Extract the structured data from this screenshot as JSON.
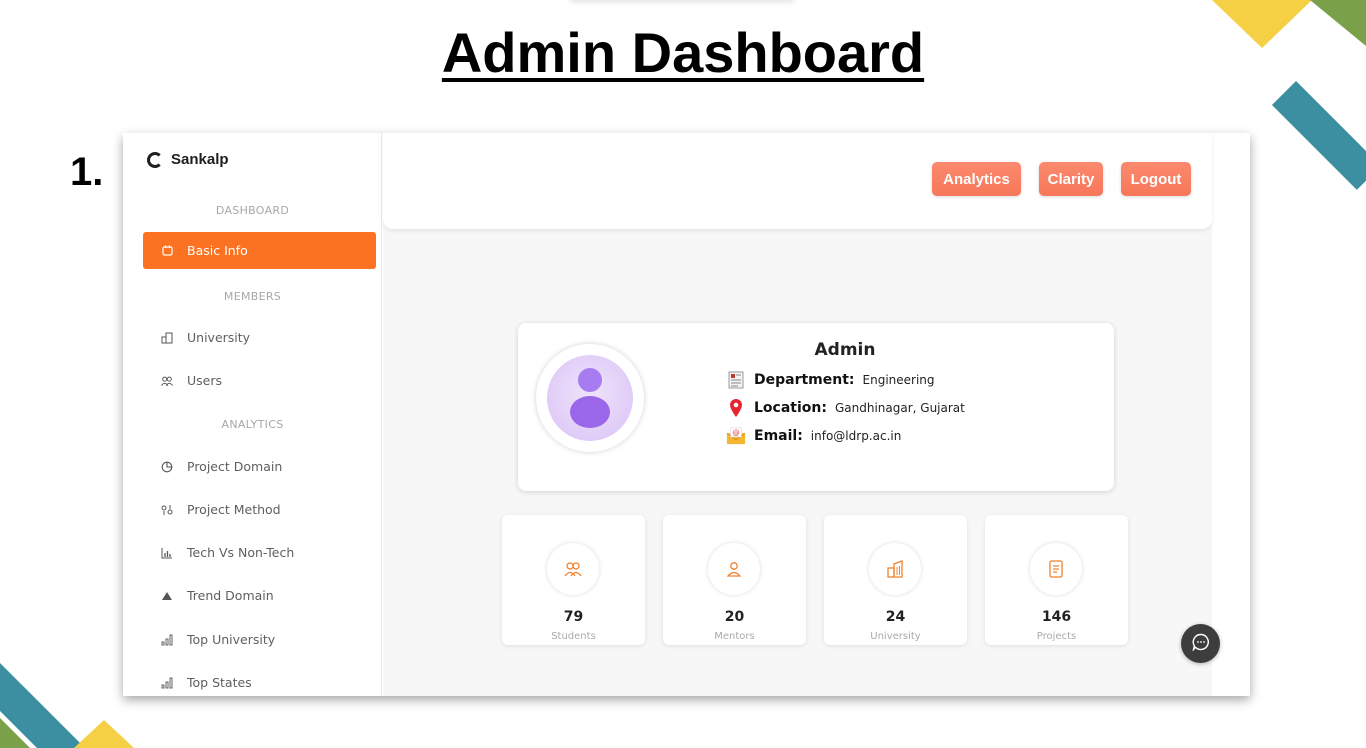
{
  "slide": {
    "title": "Admin Dashboard",
    "step": "1."
  },
  "app": {
    "brand": "Sankalp"
  },
  "sidebar": {
    "sections": [
      {
        "label": "DASHBOARD"
      },
      {
        "label": "MEMBERS"
      },
      {
        "label": "ANALYTICS"
      }
    ],
    "items": [
      {
        "label": "Basic Info",
        "icon": "calendar-icon",
        "active": true
      },
      {
        "label": "University",
        "icon": "building-icon"
      },
      {
        "label": "Users",
        "icon": "users-icon"
      },
      {
        "label": "Project Domain",
        "icon": "pie-chart-icon"
      },
      {
        "label": "Project Method",
        "icon": "method-icon"
      },
      {
        "label": "Tech Vs Non-Tech",
        "icon": "bar-chart-icon"
      },
      {
        "label": "Trend Domain",
        "icon": "triangle-icon"
      },
      {
        "label": "Top University",
        "icon": "signal-bars-icon"
      },
      {
        "label": "Top States",
        "icon": "signal-bars-icon"
      }
    ]
  },
  "header": {
    "buttons": [
      {
        "label": "Analytics"
      },
      {
        "label": "Clarity"
      },
      {
        "label": "Logout"
      }
    ]
  },
  "profile": {
    "name": "Admin",
    "department_label": "Department:",
    "department": "Engineering",
    "location_label": "Location:",
    "location": "Gandhinagar, Gujarat",
    "email_label": "Email:",
    "email": "info@ldrp.ac.in"
  },
  "stats": [
    {
      "value": "79",
      "label": "Students",
      "icon": "users-icon"
    },
    {
      "value": "20",
      "label": "Mentors",
      "icon": "person-icon"
    },
    {
      "value": "24",
      "label": "University",
      "icon": "building-icon"
    },
    {
      "value": "146",
      "label": "Projects",
      "icon": "document-icon"
    }
  ],
  "colors": {
    "accent": "#fb7322",
    "button": "#f7775a",
    "avatar": "#9a66ea"
  }
}
